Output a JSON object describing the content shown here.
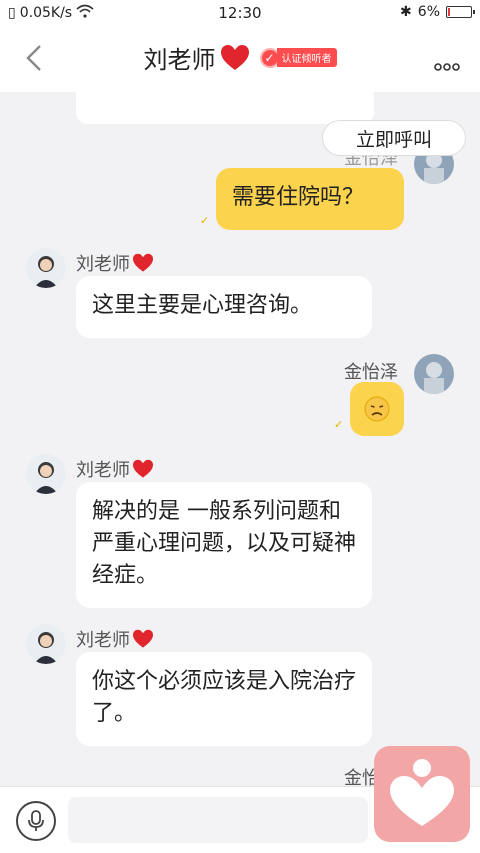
{
  "status_bar": {
    "speed": "0.05K/s",
    "time": "12:30",
    "battery": "6%",
    "battery_level": 0.06
  },
  "header": {
    "title": "刘老师",
    "badge_text": "认证倾听者"
  },
  "chat": {
    "call_button": "立即呼叫",
    "partial_name": "金怡泽",
    "messages": [
      {
        "side": "right",
        "text": "需要住院吗？"
      },
      {
        "side": "left",
        "name": "刘老师",
        "text": "这里主要是心理咨询。"
      },
      {
        "side": "right",
        "name": "金怡泽",
        "emoji": "😞"
      },
      {
        "side": "left",
        "name": "刘老师",
        "text": "解决的是 一般系列问题和严重心理问题，以及可疑神经症。"
      },
      {
        "side": "left",
        "name": "刘老师",
        "text": "你这个必须应该是入院治疗了。"
      },
      {
        "side": "right",
        "name": "金怡"
      }
    ]
  },
  "input_bar": {
    "placeholder": ""
  },
  "colors": {
    "accent_bubble": "#fcd34d",
    "heart": "#e0262c",
    "badge": "#ff4d4f",
    "float_button": "#f3a6a6"
  }
}
